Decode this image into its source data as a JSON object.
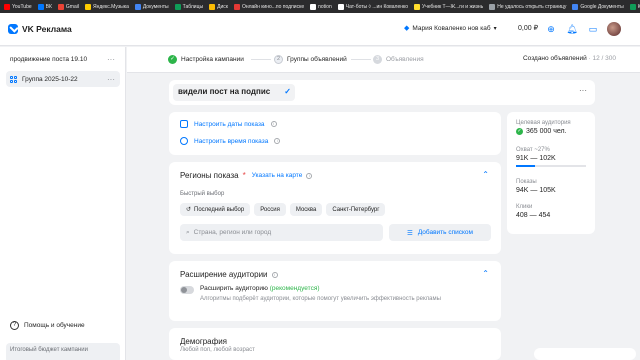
{
  "bookmarks": [
    {
      "label": "YouTube",
      "color": "#ff0000"
    },
    {
      "label": "ВК",
      "color": "#0077ff"
    },
    {
      "label": "Gmail",
      "color": "#ea4335"
    },
    {
      "label": "Яндекс.Музыка",
      "color": "#ffcc00"
    },
    {
      "label": "Документы",
      "color": "#4285f4"
    },
    {
      "label": "Таблицы",
      "color": "#0f9d58"
    },
    {
      "label": "Диск",
      "color": "#fbbc04"
    },
    {
      "label": "Онлайн кино...по подписке",
      "color": "#e53935"
    },
    {
      "label": "notion",
      "color": "#ffffff"
    },
    {
      "label": "Чат-боты ◊ ...ин Коваленко",
      "color": "#ffffff"
    },
    {
      "label": "Учебник Т—Ж...ги и жизнь",
      "color": "#ffdd2d"
    },
    {
      "label": "Не удалось открыть страницу",
      "color": "#9aa0a6"
    },
    {
      "label": "Google Документы",
      "color": "#4285f4"
    },
    {
      "label": "Копия АНКЕТА (Ответы) - Google Таблицы",
      "color": "#0f9d58"
    }
  ],
  "header": {
    "app_name": "VK Реклама",
    "account_name": "Мария Коваленко нов каб",
    "balance": "0,00 ₽"
  },
  "sidebar": {
    "items": [
      {
        "label": "продвижение поста 19.10"
      },
      {
        "label": "Группа 2025-10-22"
      }
    ],
    "help_label": "Помощь и обучение",
    "budget_label": "Итоговый бюджет кампании"
  },
  "steps": {
    "items": [
      {
        "label": "Настройка кампании",
        "marker": "✓"
      },
      {
        "label": "Группы объявлений",
        "marker": "2"
      },
      {
        "label": "Объявления",
        "marker": "3"
      }
    ],
    "created_label": "Создано объявлений",
    "created_count": "· 12 / 300"
  },
  "group_name": "видели пост на подпис",
  "schedule": {
    "dates_link": "Настроить даты показа",
    "time_link": "Настроить время показа"
  },
  "regions": {
    "title": "Регионы показа",
    "required_mark": "*",
    "map_link": "Указать на карте",
    "quick_label": "Быстрый выбор",
    "chips": [
      "Последний выбор",
      "Россия",
      "Москва",
      "Санкт-Петербург"
    ],
    "search_placeholder": "Страна, регион или город",
    "add_list_label": "Добавить списком"
  },
  "expansion": {
    "title": "Расширение аудитории",
    "toggle_label": "Расширить аудиторию",
    "toggle_rec": "(рекомендуется)",
    "description": "Алгоритмы подберёт аудитории, которые помогут увеличить эффективность рекламы"
  },
  "demography": {
    "title": "Демография",
    "subtitle": "Любой пол, любой возраст"
  },
  "audience": {
    "target_label": "Целевая аудитория",
    "target_value": "365 000 чел.",
    "reach_label": "Охват ~27%",
    "reach_value": "91K — 102K",
    "reach_fraction": 0.27,
    "shows_label": "Показы",
    "shows_value": "94K — 105K",
    "clicks_label": "Клики",
    "clicks_value": "408 — 454"
  },
  "colors": {
    "accent": "#0077ff",
    "success": "#2db54a",
    "required": "#e64646"
  }
}
